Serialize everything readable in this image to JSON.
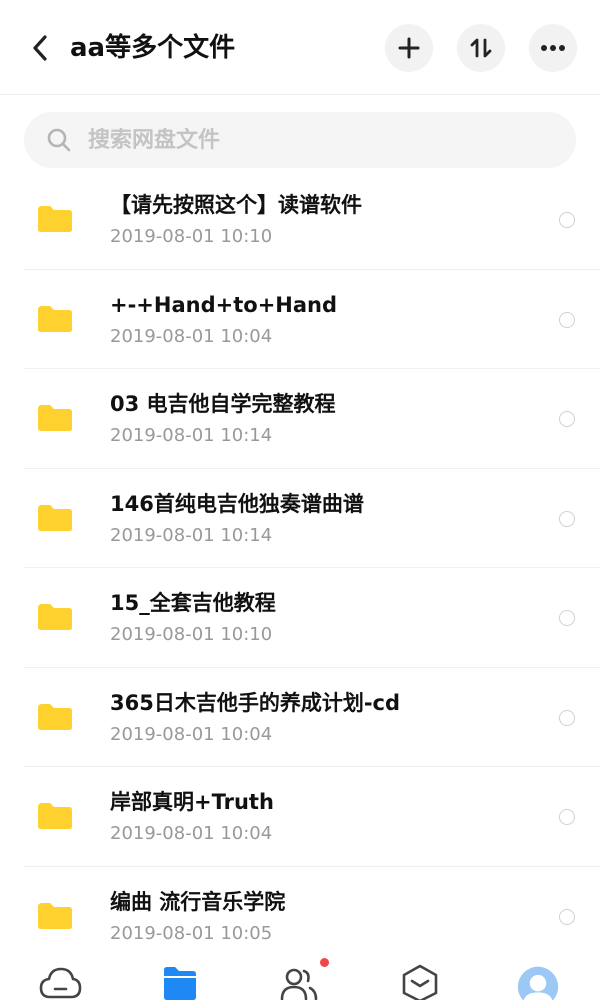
{
  "header": {
    "title": "aa等多个文件",
    "icons": {
      "back": "chevron-left-icon",
      "add": "plus-icon",
      "sort": "sort-icon",
      "more": "more-icon"
    }
  },
  "search": {
    "placeholder": "搜索网盘文件"
  },
  "files": [
    {
      "name": "【请先按照这个】读谱软件",
      "date": "2019-08-01  10:10"
    },
    {
      "name": "+-+Hand+to+Hand",
      "date": "2019-08-01  10:04"
    },
    {
      "name": "03 电吉他自学完整教程",
      "date": "2019-08-01  10:14"
    },
    {
      "name": "146首纯电吉他独奏谱曲谱",
      "date": "2019-08-01  10:14"
    },
    {
      "name": "15_全套吉他教程",
      "date": "2019-08-01  10:10"
    },
    {
      "name": "365日木吉他手的养成计划-cd",
      "date": "2019-08-01  10:04"
    },
    {
      "name": "岸部真明+Truth",
      "date": "2019-08-01  10:04"
    },
    {
      "name": "编曲 流行音乐学院",
      "date": "2019-08-01  10:05"
    }
  ],
  "tabbar": {
    "items": [
      "cloud-icon",
      "files-icon",
      "people-icon",
      "box-icon",
      "avatar"
    ],
    "active_index": 1
  },
  "colors": {
    "folder": "#FFD12E",
    "accent": "#1E88F5",
    "badge": "#F04646",
    "avatar": "#9CC8F5"
  }
}
